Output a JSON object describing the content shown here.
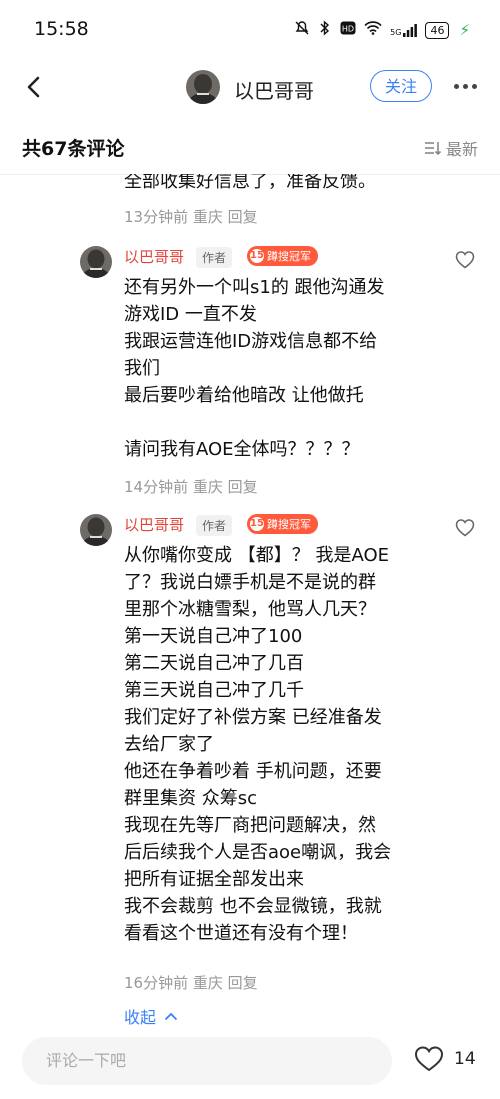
{
  "status_bar": {
    "time": "15:58",
    "network": "5G",
    "signal": "4G",
    "battery": "46"
  },
  "nav": {
    "username": "以巴哥哥",
    "follow_label": "关注"
  },
  "header": {
    "count_title": "共67条评论",
    "sort_label": "最新"
  },
  "partial_comment": {
    "text": "全部收集好信息了，准备反馈。",
    "meta": "13分钟前 重庆 回复"
  },
  "comments": [
    {
      "author": "以巴哥哥",
      "author_tag": "作者",
      "badge_number": "15",
      "badge_label": "蹲搜冠军",
      "body": "还有另外一个叫s1的 跟他沟通发\n游戏ID 一直不发\n我跟运营连他ID游戏信息都不给\n我们\n最后要吵着给他暗改 让他做托\n\n请问我有AOE全体吗？？？？",
      "meta": "14分钟前 重庆 回复"
    },
    {
      "author": "以巴哥哥",
      "author_tag": "作者",
      "badge_number": "15",
      "badge_label": "蹲搜冠军",
      "body": "从你嘴你变成 【都】？ 我是AOE\n了？我说白嫖手机是不是说的群\n里那个冰糖雪梨，他骂人几天？\n第一天说自己冲了100\n第二天说自己冲了几百\n第三天说自己冲了几千\n我们定好了补偿方案 已经准备发\n去给厂家了\n他还在争着吵着 手机问题，还要\n群里集资 众筹sc\n我现在先等厂商把问题解决，然\n后后续我个人是否aoe嘲讽，我会\n把所有证据全部发出来\n我不会裁剪 也不会显微镜，我就\n看看这个世道还有没有个理！",
      "meta": "16分钟前 重庆 回复"
    }
  ],
  "collapse_label": "收起",
  "bottom": {
    "input_placeholder": "评论一下吧",
    "like_count": "14"
  }
}
